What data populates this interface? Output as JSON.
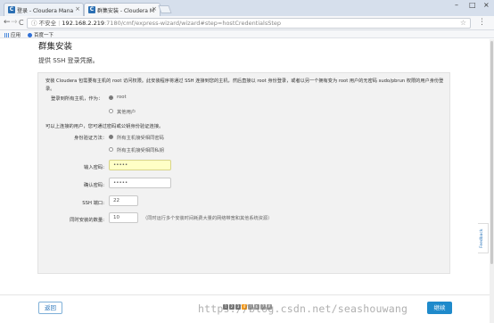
{
  "browser": {
    "tabs": [
      {
        "title": "登录 - Cloudera Mana",
        "icon_letter": "C",
        "active": false
      },
      {
        "title": "群集安装 - Cloudera M",
        "icon_letter": "C",
        "active": true
      }
    ],
    "window_controls": {
      "minimize": "–",
      "maximize": "□",
      "close": "×"
    },
    "nav": {
      "back": "←",
      "forward": "→",
      "reload": "C"
    },
    "address": {
      "security": "不安全",
      "host": "192.168.2.219",
      "path": ":7180/cmf/express-wizard/wizard#step=hostCredentialsStep"
    },
    "bookmarks": [
      {
        "label": "应用",
        "icon": "apps-grid-icon",
        "color": "#4a89dc"
      },
      {
        "label": "百度一下",
        "icon": "paw-icon",
        "color": "#2f6fd6"
      }
    ]
  },
  "page": {
    "title": "群集安装",
    "subtitle": "提供 SSH 登录凭据。",
    "description": "安装 Cloudera 包需要有主机的 root 访问权限。此安装程序将通过 SSH 连接到您的主机，然后直接以 root 身份登录，或者以另一个拥有变为 root 用户的无密码 sudo/pbrun 权限的用户身份登录。",
    "login_label": "登录到所有主机，作为：",
    "login_options": [
      "root",
      "其他用户"
    ],
    "login_selected": "root",
    "auth_intro": "可以上连接的用户，您可通过密码或公钥身份验证连接。",
    "auth_label": "身份验证方法：",
    "auth_options": [
      "所有主机接受相同密码",
      "所有主机接受相同私钥"
    ],
    "auth_selected": "所有主机接受相同密码",
    "password_label": "输入密码:",
    "password_value": "•••••",
    "confirm_label": "确认密码:",
    "confirm_value": "•••••",
    "ssh_port_label": "SSH 端口:",
    "ssh_port_value": "22",
    "concurrent_label": "同时安装的数量:",
    "concurrent_value": "10",
    "concurrent_hint": "（同时运行多个安装时间耗费大量的网络带宽和其他系统资源）"
  },
  "footer": {
    "back_label": "返回",
    "continue_label": "继续",
    "steps": [
      "1",
      "2",
      "3",
      "4",
      "5",
      "6",
      "7",
      "8"
    ],
    "current_step": 4,
    "watermark": "https://blog.csdn.net/seashouwang"
  },
  "feedback_label": "Feedback",
  "colors": {
    "accent": "#1f8acb",
    "current_step": "#f39a1e",
    "focused_input": "#ffffc6"
  }
}
